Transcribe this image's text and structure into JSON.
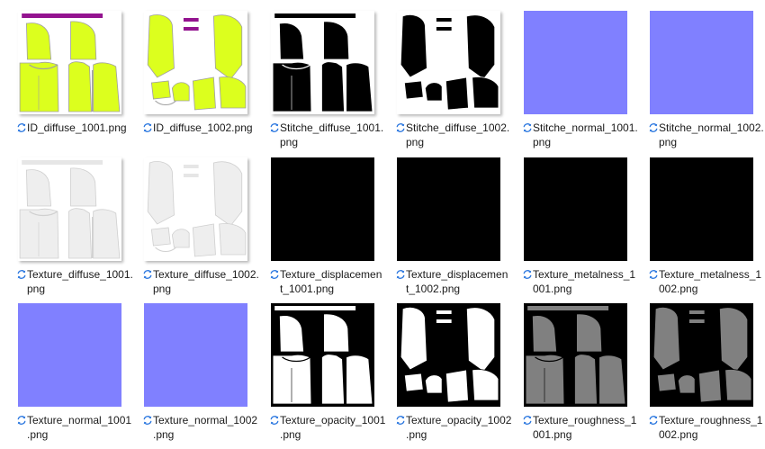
{
  "files": [
    {
      "name_line1": "ID_diffuse_1001.png",
      "name_line2": "",
      "kind": "uv-first",
      "bg": "#ffffff",
      "fill": "#dcff1e",
      "bar": "#93138f",
      "outline": "#a0a0a0",
      "icon": "sync-icon"
    },
    {
      "name_line1": "ID_diffuse_1002.png",
      "name_line2": "",
      "kind": "uv-second",
      "bg": "#ffffff",
      "fill": "#dcff1e",
      "bar": "#93138f",
      "outline": "#a0a0a0",
      "icon": "sync-icon"
    },
    {
      "name_line1": "Stitche_diffuse_1001.",
      "name_line2": "png",
      "kind": "uv-first",
      "bg": "#ffffff",
      "fill": "#000000",
      "bar": "#000000",
      "outline": "#ffffff",
      "icon": "sync-icon"
    },
    {
      "name_line1": "Stitche_diffuse_1002.",
      "name_line2": "png",
      "kind": "uv-second",
      "bg": "#ffffff",
      "fill": "#000000",
      "bar": "#000000",
      "outline": "#ffffff",
      "icon": "sync-icon"
    },
    {
      "name_line1": "Stitche_normal_1001.",
      "name_line2": "png",
      "kind": "solid",
      "bg": "#8080ff",
      "fill": "#8080ff",
      "bar": "#8080ff",
      "outline": "#8080ff",
      "icon": "sync-icon"
    },
    {
      "name_line1": "Stitche_normal_1002.",
      "name_line2": "png",
      "kind": "solid",
      "bg": "#8080ff",
      "fill": "#8080ff",
      "bar": "#8080ff",
      "outline": "#8080ff",
      "icon": "sync-icon"
    },
    {
      "name_line1": "Texture_diffuse_1001.",
      "name_line2": "png",
      "kind": "uv-first",
      "bg": "#ffffff",
      "fill": "#eeeeee",
      "bar": "#e6e6e6",
      "outline": "#d0d0d0",
      "icon": "sync-icon"
    },
    {
      "name_line1": "Texture_diffuse_1002.",
      "name_line2": "png",
      "kind": "uv-second",
      "bg": "#ffffff",
      "fill": "#eeeeee",
      "bar": "#e6e6e6",
      "outline": "#d0d0d0",
      "icon": "sync-icon"
    },
    {
      "name_line1": "Texture_displacemen",
      "name_line2": "t_1001.png",
      "kind": "solid",
      "bg": "#000000",
      "fill": "#000000",
      "bar": "#000000",
      "outline": "#000000",
      "icon": "sync-icon"
    },
    {
      "name_line1": "Texture_displacemen",
      "name_line2": "t_1002.png",
      "kind": "solid",
      "bg": "#000000",
      "fill": "#000000",
      "bar": "#000000",
      "outline": "#000000",
      "icon": "sync-icon"
    },
    {
      "name_line1": "Texture_metalness_1",
      "name_line2": "001.png",
      "kind": "solid",
      "bg": "#000000",
      "fill": "#000000",
      "bar": "#000000",
      "outline": "#000000",
      "icon": "sync-icon"
    },
    {
      "name_line1": "Texture_metalness_1",
      "name_line2": "002.png",
      "kind": "solid",
      "bg": "#000000",
      "fill": "#000000",
      "bar": "#000000",
      "outline": "#000000",
      "icon": "sync-icon"
    },
    {
      "name_line1": "Texture_normal_1001",
      "name_line2": ".png",
      "kind": "solid",
      "bg": "#8080ff",
      "fill": "#8080ff",
      "bar": "#8080ff",
      "outline": "#8080ff",
      "icon": "sync-icon"
    },
    {
      "name_line1": "Texture_normal_1002",
      "name_line2": ".png",
      "kind": "solid",
      "bg": "#8080ff",
      "fill": "#8080ff",
      "bar": "#8080ff",
      "outline": "#8080ff",
      "icon": "sync-icon"
    },
    {
      "name_line1": "Texture_opacity_1001",
      "name_line2": ".png",
      "kind": "uv-first",
      "bg": "#000000",
      "fill": "#ffffff",
      "bar": "#ffffff",
      "outline": "#000000",
      "icon": "sync-icon"
    },
    {
      "name_line1": "Texture_opacity_1002",
      "name_line2": ".png",
      "kind": "uv-second",
      "bg": "#000000",
      "fill": "#ffffff",
      "bar": "#ffffff",
      "outline": "#000000",
      "icon": "sync-icon"
    },
    {
      "name_line1": "Texture_roughness_1",
      "name_line2": "001.png",
      "kind": "uv-first",
      "bg": "#000000",
      "fill": "#808080",
      "bar": "#808080",
      "outline": "#000000",
      "icon": "sync-icon"
    },
    {
      "name_line1": "Texture_roughness_1",
      "name_line2": "002.png",
      "kind": "uv-second",
      "bg": "#000000",
      "fill": "#808080",
      "bar": "#808080",
      "outline": "#000000",
      "icon": "sync-icon"
    }
  ]
}
